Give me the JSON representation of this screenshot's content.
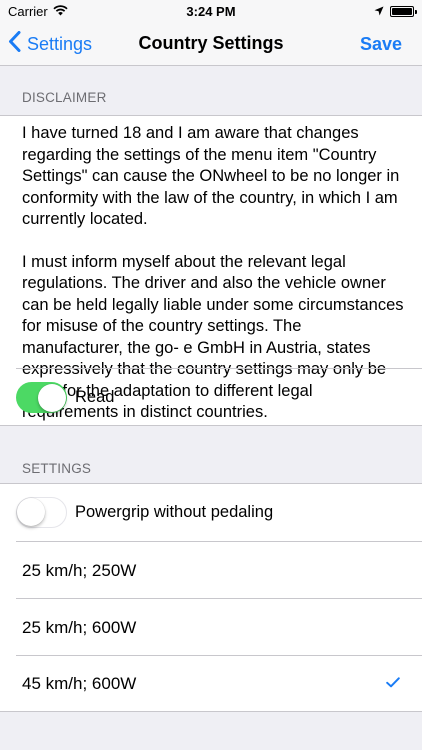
{
  "status": {
    "carrier": "Carrier",
    "time": "3:24 PM"
  },
  "nav": {
    "back_label": "Settings",
    "title": "Country Settings",
    "save_label": "Save"
  },
  "disclaimer": {
    "header": "DISCLAIMER",
    "paragraph1": "I have turned 18 and I am aware that changes regarding the settings of the menu item \"Country Settings\" can cause the ONwheel to be no longer in conformity with the law of the country, in which I am currently located.",
    "paragraph2": "I must inform myself about the relevant legal regulations. The driver and also the vehicle owner can be held legally liable under some circumstances for misuse of the country settings. The manufacturer, the go- e GmbH in Austria, states expressively that the country settings may only be used for the adaptation to different legal requirements in distinct countries.",
    "read_label": "Read",
    "read_on": true
  },
  "settings": {
    "header": "SETTINGS",
    "powergrip_label": "Powergrip without pedaling",
    "powergrip_on": false,
    "options": [
      {
        "label": "25 km/h; 250W",
        "selected": false
      },
      {
        "label": "25 km/h; 600W",
        "selected": false
      },
      {
        "label": "45 km/h; 600W",
        "selected": true
      }
    ]
  },
  "colors": {
    "accent": "#1a7cf5",
    "toggle_on": "#4cd964",
    "background": "#efeff4"
  }
}
